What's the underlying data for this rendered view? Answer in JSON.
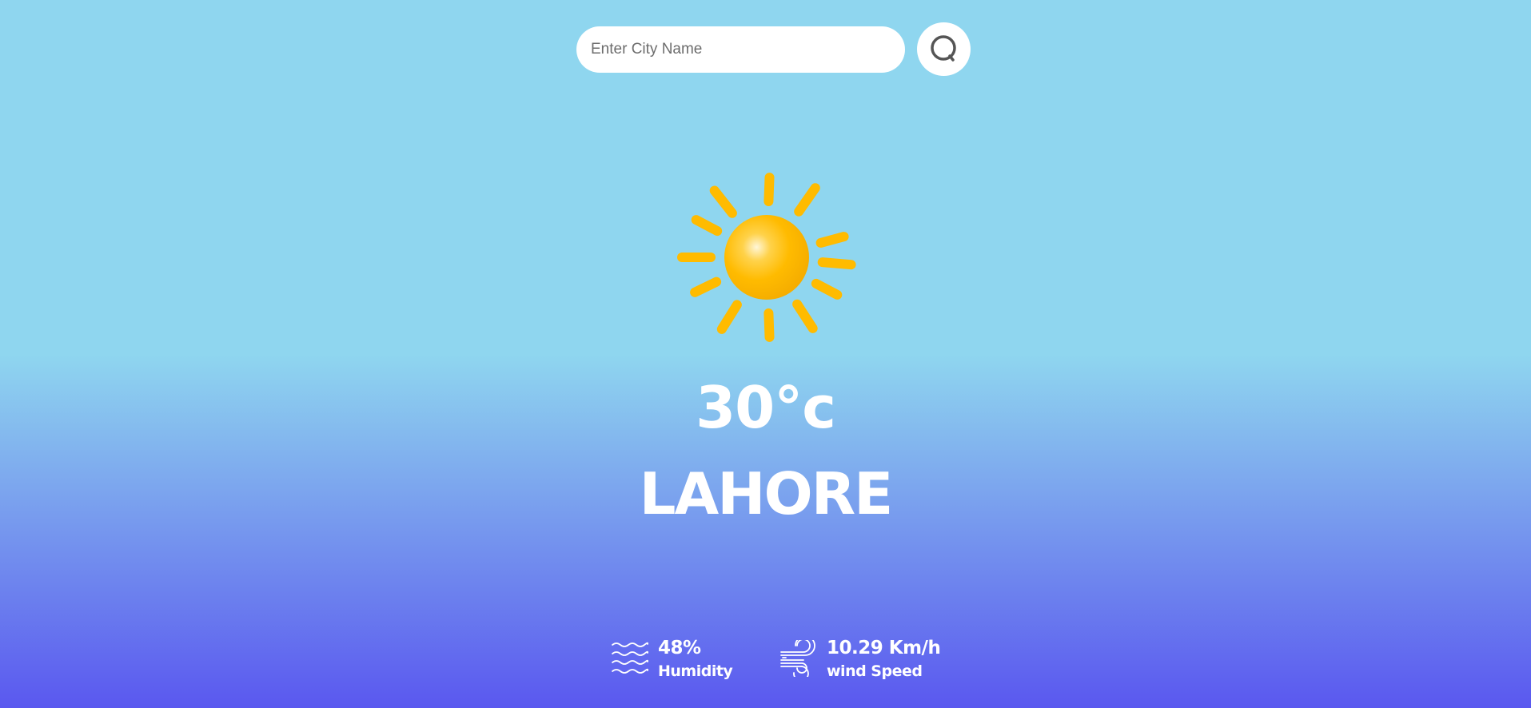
{
  "search": {
    "placeholder": "Enter City Name",
    "value": "",
    "button_icon": "search-icon"
  },
  "weather": {
    "icon": "sun-icon",
    "temperature": "30°c",
    "city": "LAHORE"
  },
  "details": {
    "humidity": {
      "icon": "humidity-icon",
      "value": "48%",
      "label": "Humidity"
    },
    "wind": {
      "icon": "wind-icon",
      "value": "10.29 Km/h",
      "label": "wind Speed"
    }
  },
  "colors": {
    "background_top": "#8fd6ef",
    "background_bottom": "#5a58ef",
    "sun": "#ffbb00",
    "text": "#ffffff"
  }
}
